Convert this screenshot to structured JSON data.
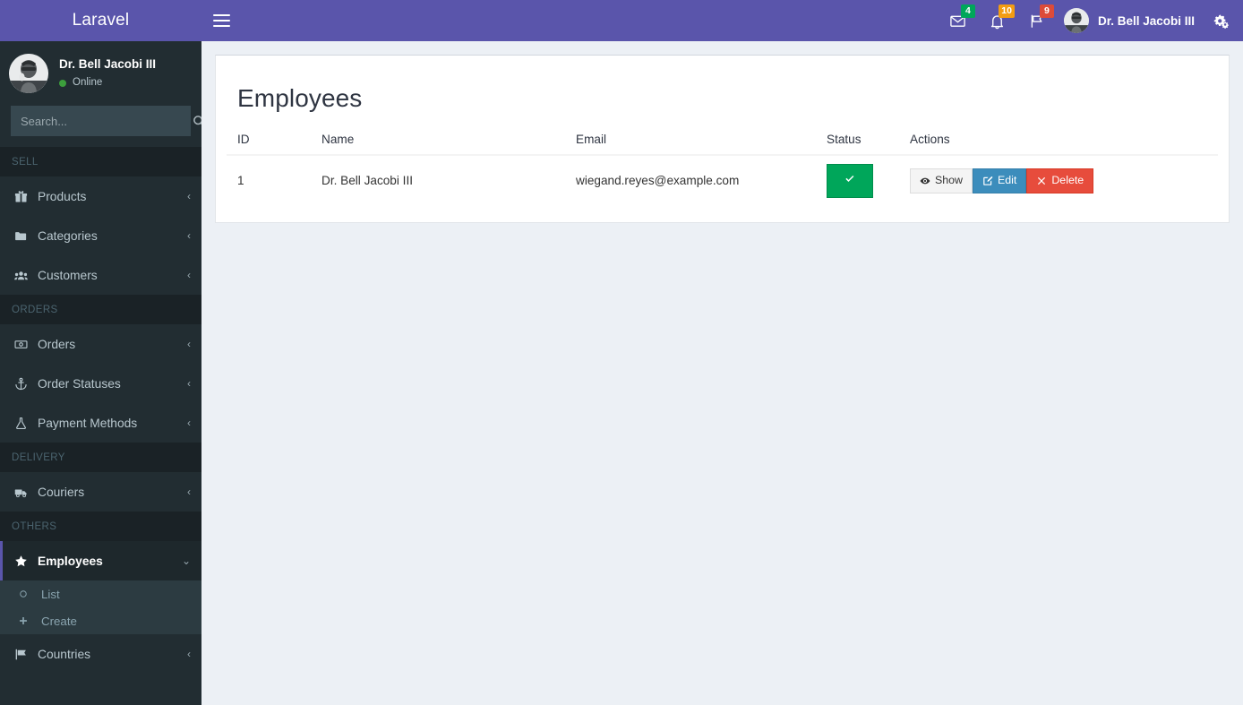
{
  "brand": {
    "name": "Laravel"
  },
  "sidebar": {
    "user": {
      "name": "Dr. Bell Jacobi III",
      "status": "Online"
    },
    "search": {
      "placeholder": "Search...",
      "value": ""
    },
    "sections": [
      {
        "header": "SELL",
        "items": [
          {
            "label": "Products",
            "icon": "gift-icon",
            "chevron": "‹",
            "active": false
          },
          {
            "label": "Categories",
            "icon": "folder-icon",
            "chevron": "‹",
            "active": false
          },
          {
            "label": "Customers",
            "icon": "users-icon",
            "chevron": "‹",
            "active": false
          }
        ]
      },
      {
        "header": "ORDERS",
        "items": [
          {
            "label": "Orders",
            "icon": "money-bill-icon",
            "chevron": "‹",
            "active": false
          },
          {
            "label": "Order Statuses",
            "icon": "anchor-icon",
            "chevron": "‹",
            "active": false
          },
          {
            "label": "Payment Methods",
            "icon": "flask-icon",
            "chevron": "‹",
            "active": false
          }
        ]
      },
      {
        "header": "DELIVERY",
        "items": [
          {
            "label": "Couriers",
            "icon": "truck-icon",
            "chevron": "‹",
            "active": false
          }
        ]
      },
      {
        "header": "OTHERS",
        "items": [
          {
            "label": "Employees",
            "icon": "star-icon",
            "chevron": "⌄",
            "active": true,
            "submenu": [
              {
                "label": "List",
                "icon": "circle-o-icon"
              },
              {
                "label": "Create",
                "icon": "plus-icon"
              }
            ]
          },
          {
            "label": "Countries",
            "icon": "flag-icon",
            "chevron": "‹",
            "active": false
          }
        ]
      }
    ]
  },
  "navbar": {
    "menu_toggle": "hamburger-icon",
    "notifications": [
      {
        "icon": "envelope-icon",
        "count": "4",
        "color": "#00a65a"
      },
      {
        "icon": "bell-icon",
        "count": "10",
        "color": "#f39c12"
      },
      {
        "icon": "flag-icon",
        "count": "9",
        "color": "#dd4b39"
      }
    ],
    "user_name": "Dr. Bell Jacobi III",
    "settings_icon": "cogs-icon"
  },
  "main": {
    "page_title": "Employees",
    "table": {
      "columns": [
        "ID",
        "Name",
        "Email",
        "Status",
        "Actions"
      ],
      "rows": [
        {
          "id": "1",
          "name": "Dr. Bell Jacobi III",
          "email": "wiegand.reyes@example.com",
          "status": "active",
          "actions": [
            {
              "label": "Show",
              "icon": "eye-icon",
              "style": "btn-default"
            },
            {
              "label": "Edit",
              "icon": "pencil-square-icon",
              "style": "btn-info"
            },
            {
              "label": "Delete",
              "icon": "times-icon",
              "style": "btn-danger"
            }
          ]
        }
      ]
    }
  },
  "colors": {
    "navbar_purple": "#5a55ab",
    "sidebar_dark": "#222d32",
    "sidebar_header": "#1a2226",
    "submenu": "#2c3b41",
    "content_bg": "#ecf0f5",
    "success": "#00a65a",
    "info": "#3c8dbc",
    "danger": "#e74c3c",
    "warning": "#f39c12"
  }
}
